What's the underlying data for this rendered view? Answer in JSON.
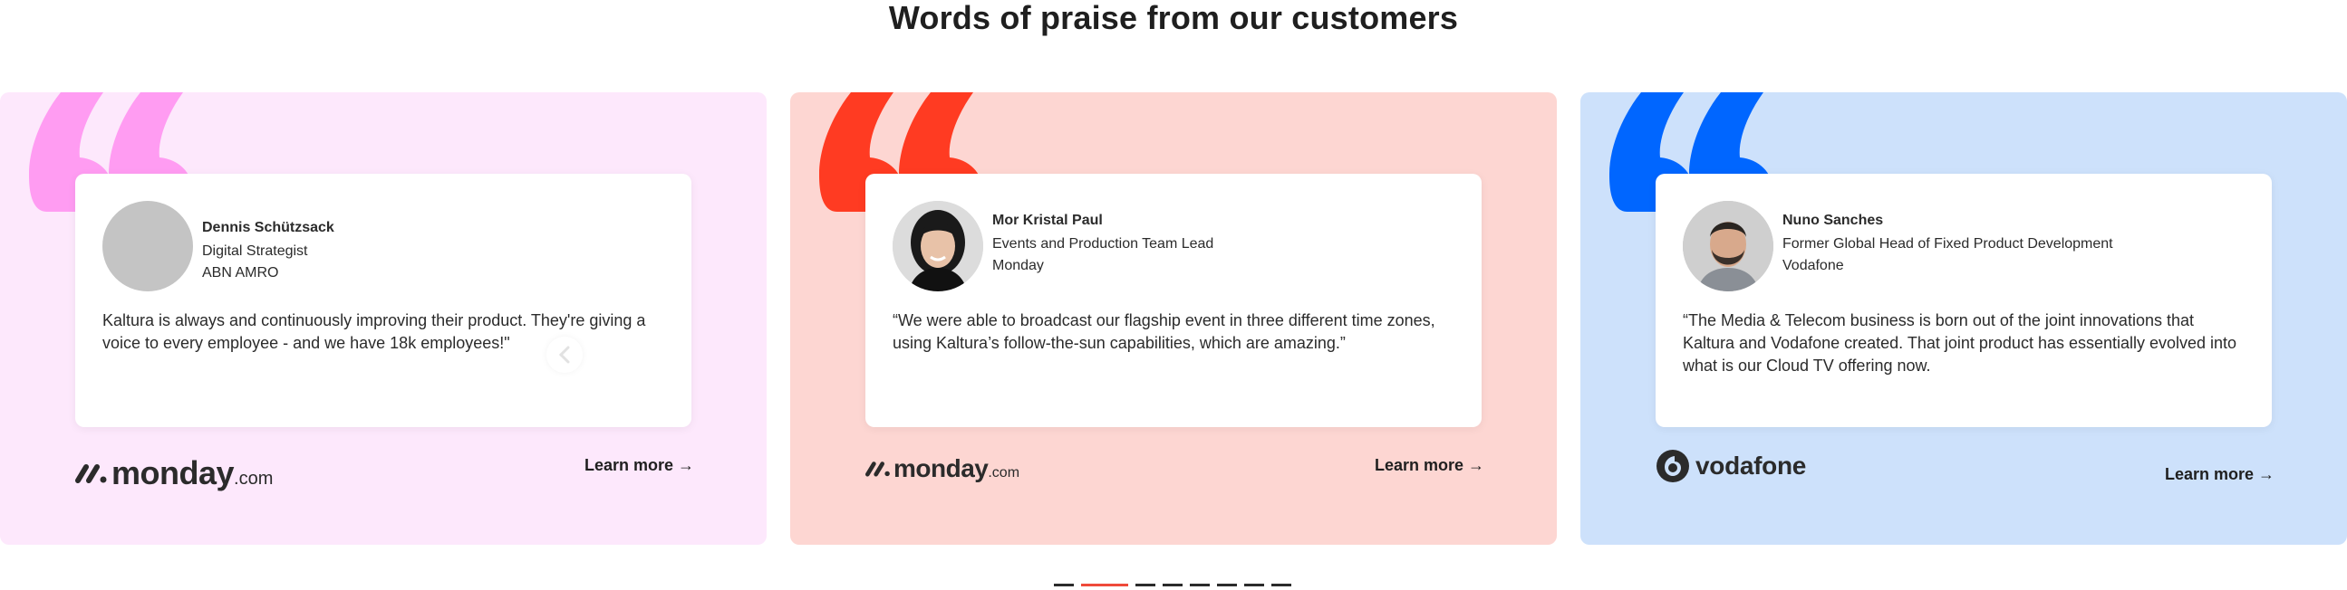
{
  "section": {
    "title": "Words of praise from our customers"
  },
  "cards": [
    {
      "background": "#fde8fc",
      "quote_color": "#ff9cf2",
      "person": {
        "name": "Dennis Schützsack",
        "role": "Digital Strategist",
        "company": "ABN AMRO"
      },
      "quote": "Kaltura is always and continuously improving their product. They're giving a voice to every employee - and we have 18k employees!\"",
      "logo": {
        "word": "monday",
        "suffix": ".com",
        "icon": "monday-logo-icon"
      },
      "learn_more": "Learn more →"
    },
    {
      "background": "#fdd6d2",
      "quote_color": "#ff3b22",
      "person": {
        "name": "Mor Kristal Paul",
        "role": "Events and Production Team Lead",
        "company": "Monday"
      },
      "quote": "“We were able to broadcast our flagship event in three different time zones, using Kaltura’s follow-the-sun capabilities, which are amazing.”",
      "logo": {
        "word": "monday",
        "suffix": ".com",
        "icon": "monday-logo-icon"
      },
      "learn_more": "Learn more →"
    },
    {
      "background": "#cde1fb",
      "quote_color": "#0066ff",
      "person": {
        "name": "Nuno Sanches",
        "role": "Former Global Head of Fixed Product Development",
        "company": "Vodafone"
      },
      "quote": "“The Media & Telecom business is born out of the joint innovations that Kaltura and Vodafone created. That joint product has essentially evolved into what is our Cloud TV offering now.",
      "logo": {
        "word": "vodafone",
        "icon": "vodafone-logo-icon"
      },
      "learn_more": "Learn more →"
    }
  ],
  "carousel": {
    "dot_count": 8,
    "active_index": 1,
    "active_color": "#ef4a3a"
  }
}
